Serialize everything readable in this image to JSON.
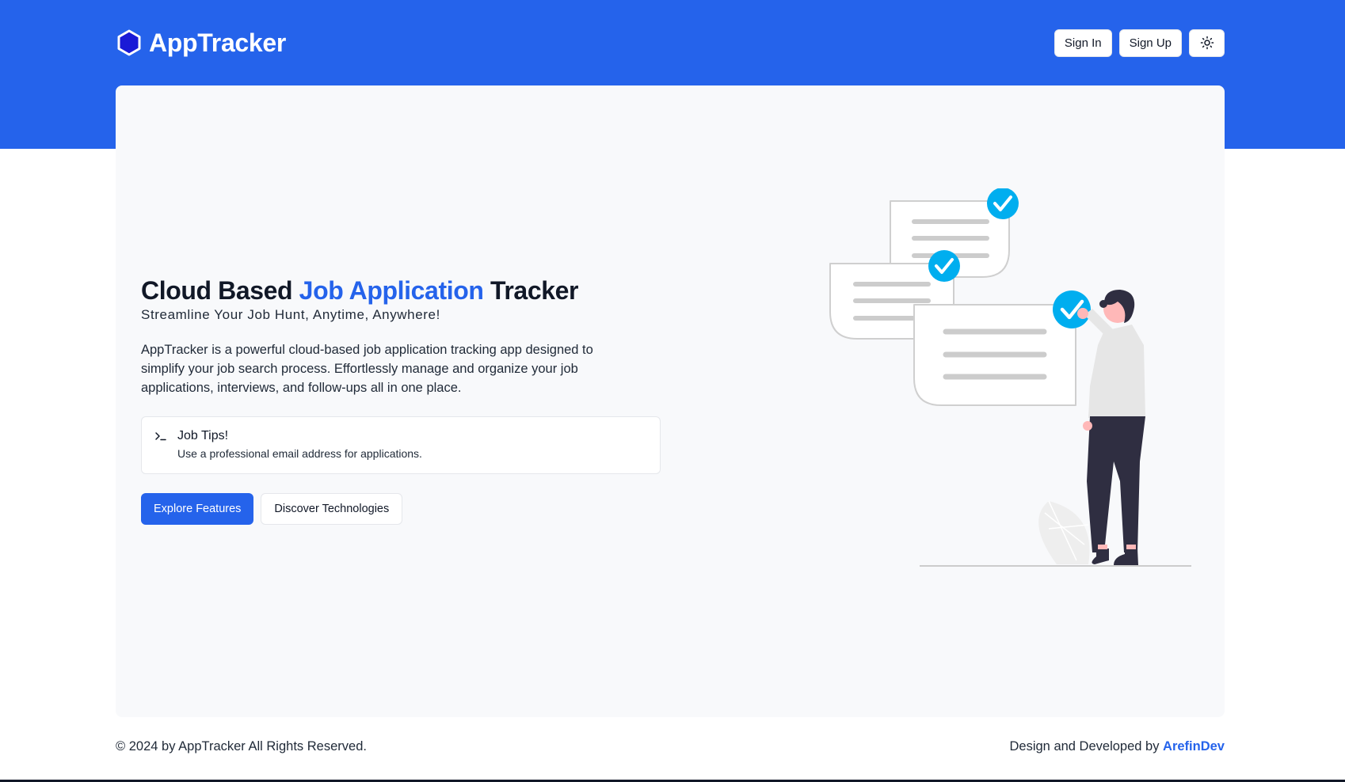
{
  "colors": {
    "brand": "#2563eb",
    "card_bg": "#f8f9fb",
    "check_accent": "#00aeef",
    "figure_shirt": "#e6e6e6",
    "figure_pants": "#2f2e41"
  },
  "navbar": {
    "brand_icon": "hexagon-icon",
    "brand_name": "AppTracker",
    "sign_in_label": "Sign In",
    "sign_up_label": "Sign Up",
    "theme_icon": "sun-icon"
  },
  "hero": {
    "title_prefix": "Cloud Based ",
    "title_accent": "Job Application",
    "title_suffix": " Tracker",
    "subtitle": "Streamline Your Job Hunt, Anytime, Anywhere!",
    "description": "AppTracker is a powerful cloud-based job application tracking app designed to simplify your job search process. Effortlessly manage and organize your job applications, interviews, and follow-ups all in one place.",
    "tip": {
      "icon": "terminal-icon",
      "title": "Job Tips!",
      "text": "Use a professional email address for applications."
    },
    "primary_button": "Explore Features",
    "secondary_button": "Discover Technologies"
  },
  "illustration": {
    "description_icon": "person-checking-documents-illustration"
  },
  "footer": {
    "copyright": "© 2024 by AppTracker All Rights Reserved.",
    "credit_prefix": "Design and Developed by ",
    "credit_link": "ArefinDev"
  }
}
